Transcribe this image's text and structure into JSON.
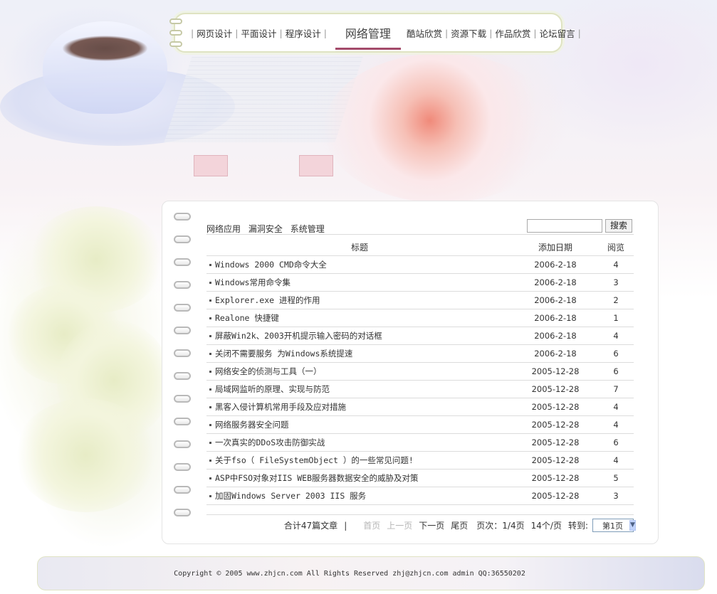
{
  "nav": {
    "items": [
      "网页设计",
      "平面设计",
      "程序设计",
      "网络管理",
      "酷站欣赏",
      "资源下载",
      "作品欣赏",
      "论坛留言"
    ],
    "active": "网络管理"
  },
  "categories": [
    "网络应用",
    "漏洞安全",
    "系统管理"
  ],
  "search": {
    "value": "",
    "button": "搜索"
  },
  "table": {
    "headers": {
      "title": "标题",
      "date": "添加日期",
      "views": "阅览"
    },
    "rows": [
      {
        "title": "Windows 2000 CMD命令大全",
        "date": "2006-2-18",
        "views": "4"
      },
      {
        "title": "Windows常用命令集",
        "date": "2006-2-18",
        "views": "3"
      },
      {
        "title": "Explorer.exe 进程的作用",
        "date": "2006-2-18",
        "views": "2"
      },
      {
        "title": "Realone 快捷键",
        "date": "2006-2-18",
        "views": "1"
      },
      {
        "title": "屏蔽Win2k、2003开机提示输入密码的对话框",
        "date": "2006-2-18",
        "views": "4"
      },
      {
        "title": "关闭不需要服务 为Windows系统提速",
        "date": "2006-2-18",
        "views": "6"
      },
      {
        "title": "网络安全的侦测与工具（一）",
        "date": "2005-12-28",
        "views": "6"
      },
      {
        "title": "局域网监听的原理、实现与防范",
        "date": "2005-12-28",
        "views": "7"
      },
      {
        "title": "黑客入侵计算机常用手段及应对措施",
        "date": "2005-12-28",
        "views": "4"
      },
      {
        "title": "网络服务器安全问题",
        "date": "2005-12-28",
        "views": "4"
      },
      {
        "title": "一次真实的DDoS攻击防御实战",
        "date": "2005-12-28",
        "views": "6"
      },
      {
        "title": "关于fso（ FileSystemObject ）的一些常见问题!",
        "date": "2005-12-28",
        "views": "4"
      },
      {
        "title": "ASP中FSO对象对IIS WEB服务器数据安全的威胁及对策",
        "date": "2005-12-28",
        "views": "5"
      },
      {
        "title": "加固Windows Server 2003 IIS 服务",
        "date": "2005-12-28",
        "views": "3"
      }
    ]
  },
  "pager": {
    "total": "合计47篇文章",
    "separator": "|",
    "first": "首页",
    "prev": "上一页",
    "next": "下一页",
    "last": "尾页",
    "page_info": "页次：1/4页",
    "per_page": "14个/页",
    "goto": "转到:",
    "selected": "第1页"
  },
  "footer": {
    "copyright": "Copyright © 2005 www.zhjcn.com All Rights Reserved zhj@zhjcn.com admin QQ:36550202"
  },
  "icons": {
    "page_select_arrow": "chevron-down-icon",
    "binder_ring": "ring-icon"
  }
}
